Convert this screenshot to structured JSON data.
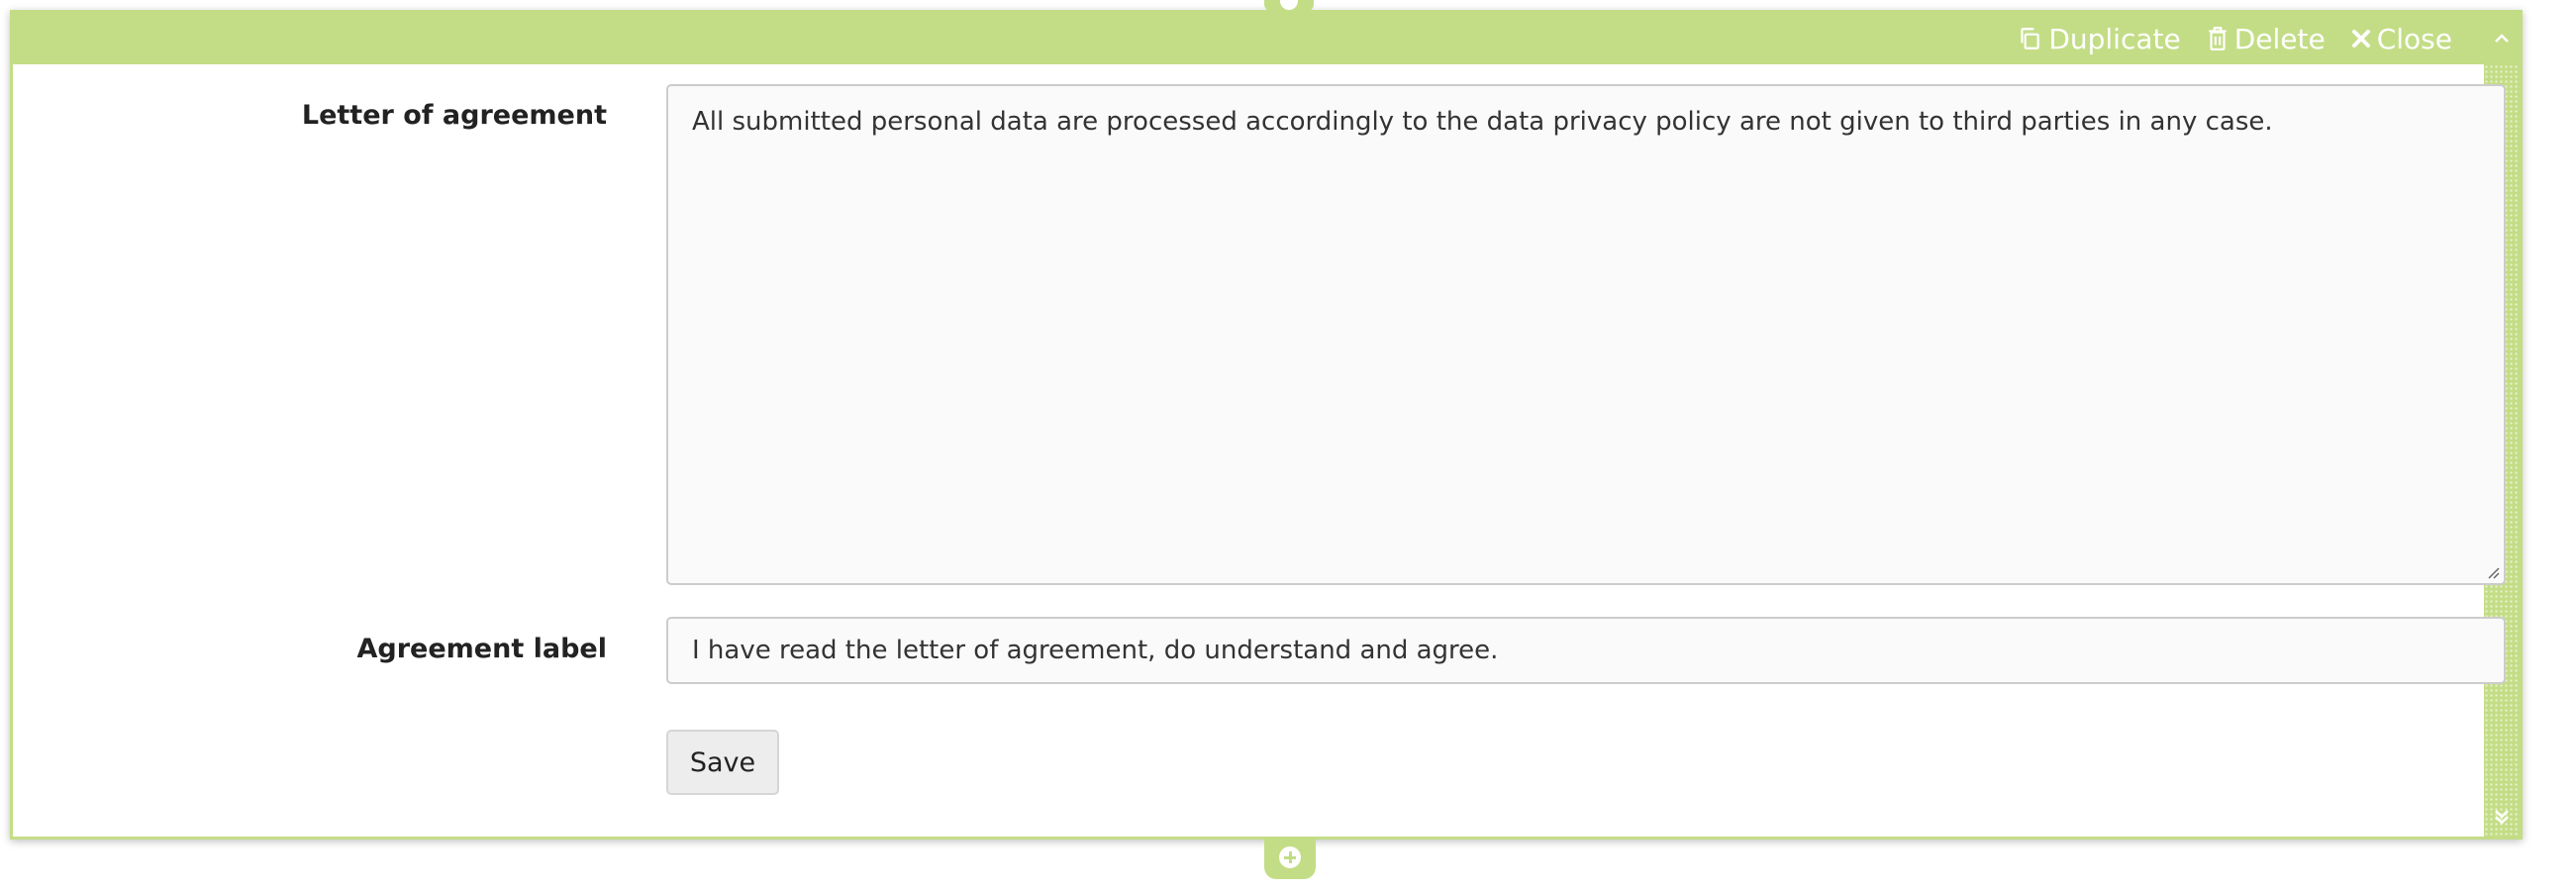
{
  "toolbar": {
    "duplicate_label": "Duplicate",
    "delete_label": "Delete",
    "close_label": "Close"
  },
  "form": {
    "letter_label": "Letter of agreement",
    "letter_value": "All submitted personal data are processed accordingly to the data privacy policy are not given to third parties in any case.",
    "agreement_label": "Agreement label",
    "agreement_value": "I have read the letter of agreement, do understand and agree.",
    "save_label": "Save"
  },
  "colors": {
    "accent": "#c3dd86",
    "field_background": "#fafafa",
    "border": "#cccccc"
  },
  "icons": {
    "duplicate": "copy-icon",
    "delete": "trash-icon",
    "close": "close-icon",
    "collapse": "chevron-up-icon",
    "expand": "double-chevron-down-icon",
    "add": "plus-circle-icon"
  }
}
